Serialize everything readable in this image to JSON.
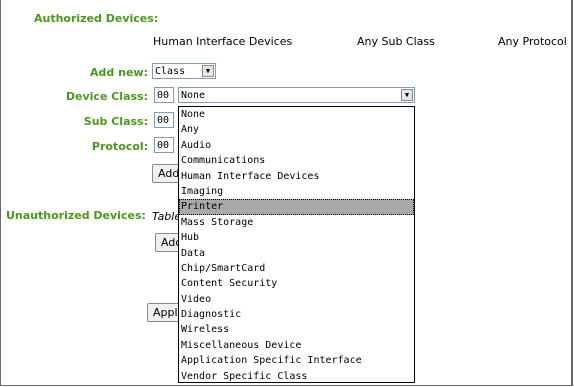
{
  "authorized": {
    "title": "Authorized Devices:",
    "row": [
      "Human Interface Devices",
      "Any Sub Class",
      "Any Protocol"
    ]
  },
  "form": {
    "add_new_label": "Add new:",
    "add_new_value": "Class",
    "device_class_label": "Device Class:",
    "device_class_code": "00",
    "device_class_value": "None",
    "sub_class_label": "Sub Class:",
    "sub_class_code": "00",
    "protocol_label": "Protocol:",
    "protocol_code": "00",
    "add_button_label": "Add"
  },
  "unauthorized": {
    "title": "Unauthorized Devices:",
    "table_text": "Table",
    "add_button_label": "Add",
    "apply_button_label": "Apply"
  },
  "dropdown": {
    "selected_index": 6,
    "options": [
      "None",
      "Any",
      "Audio",
      "Communications",
      "Human Interface Devices",
      "Imaging",
      "Printer",
      "Mass Storage",
      "Hub",
      "Data",
      "Chip/SmartCard",
      "Content Security",
      "Video",
      "Diagnostic",
      "Wireless",
      "Miscellaneous Device",
      "Application Specific Interface",
      "Vendor Specific Class"
    ]
  },
  "colors": {
    "label_green": "#4a9a1a",
    "highlight": "#a9a9a9"
  }
}
